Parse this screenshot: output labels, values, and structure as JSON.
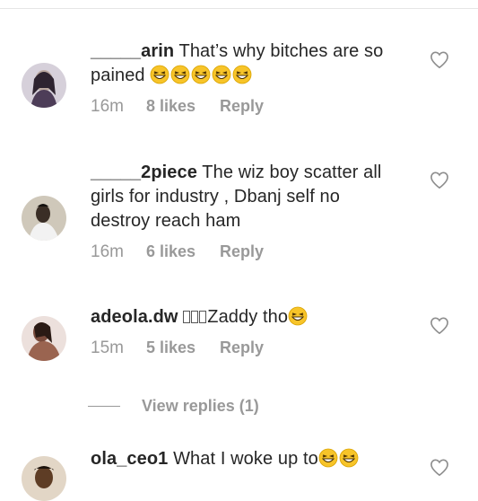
{
  "comments": [
    {
      "username": "_____arin",
      "text": "That’s why bitches are so pained",
      "emojis": 5,
      "age": "16m",
      "likes": "8 likes",
      "reply": "Reply",
      "avatar_colors": [
        "#c9c2cf",
        "#6a5a76"
      ]
    },
    {
      "username": "_____2piece",
      "text": "The wiz boy scatter all girls for industry , Dbanj self no destroy reach ham",
      "emojis": 0,
      "age": "16m",
      "likes": "6 likes",
      "reply": "Reply",
      "avatar_colors": [
        "#d8d2c4",
        "#2a2620"
      ]
    },
    {
      "username": "adeola.dw",
      "text": "Zaddy tho",
      "emojis": 1,
      "age": "15m",
      "likes": "5 likes",
      "reply": "Reply",
      "avatar_colors": [
        "#e7d3cf",
        "#8a5a4a"
      ]
    },
    {
      "username": "ola_ceo1",
      "text": "What I woke up to",
      "emojis": 2,
      "age": "",
      "likes": "",
      "reply": "",
      "avatar_colors": [
        "#d7c3a8",
        "#5a3a22"
      ]
    }
  ],
  "view_replies": {
    "label": "View replies (1)"
  },
  "colors": {
    "text": "#262626",
    "meta": "#999999",
    "heart": "#8e8e8e",
    "emoji": "#f7c429"
  }
}
